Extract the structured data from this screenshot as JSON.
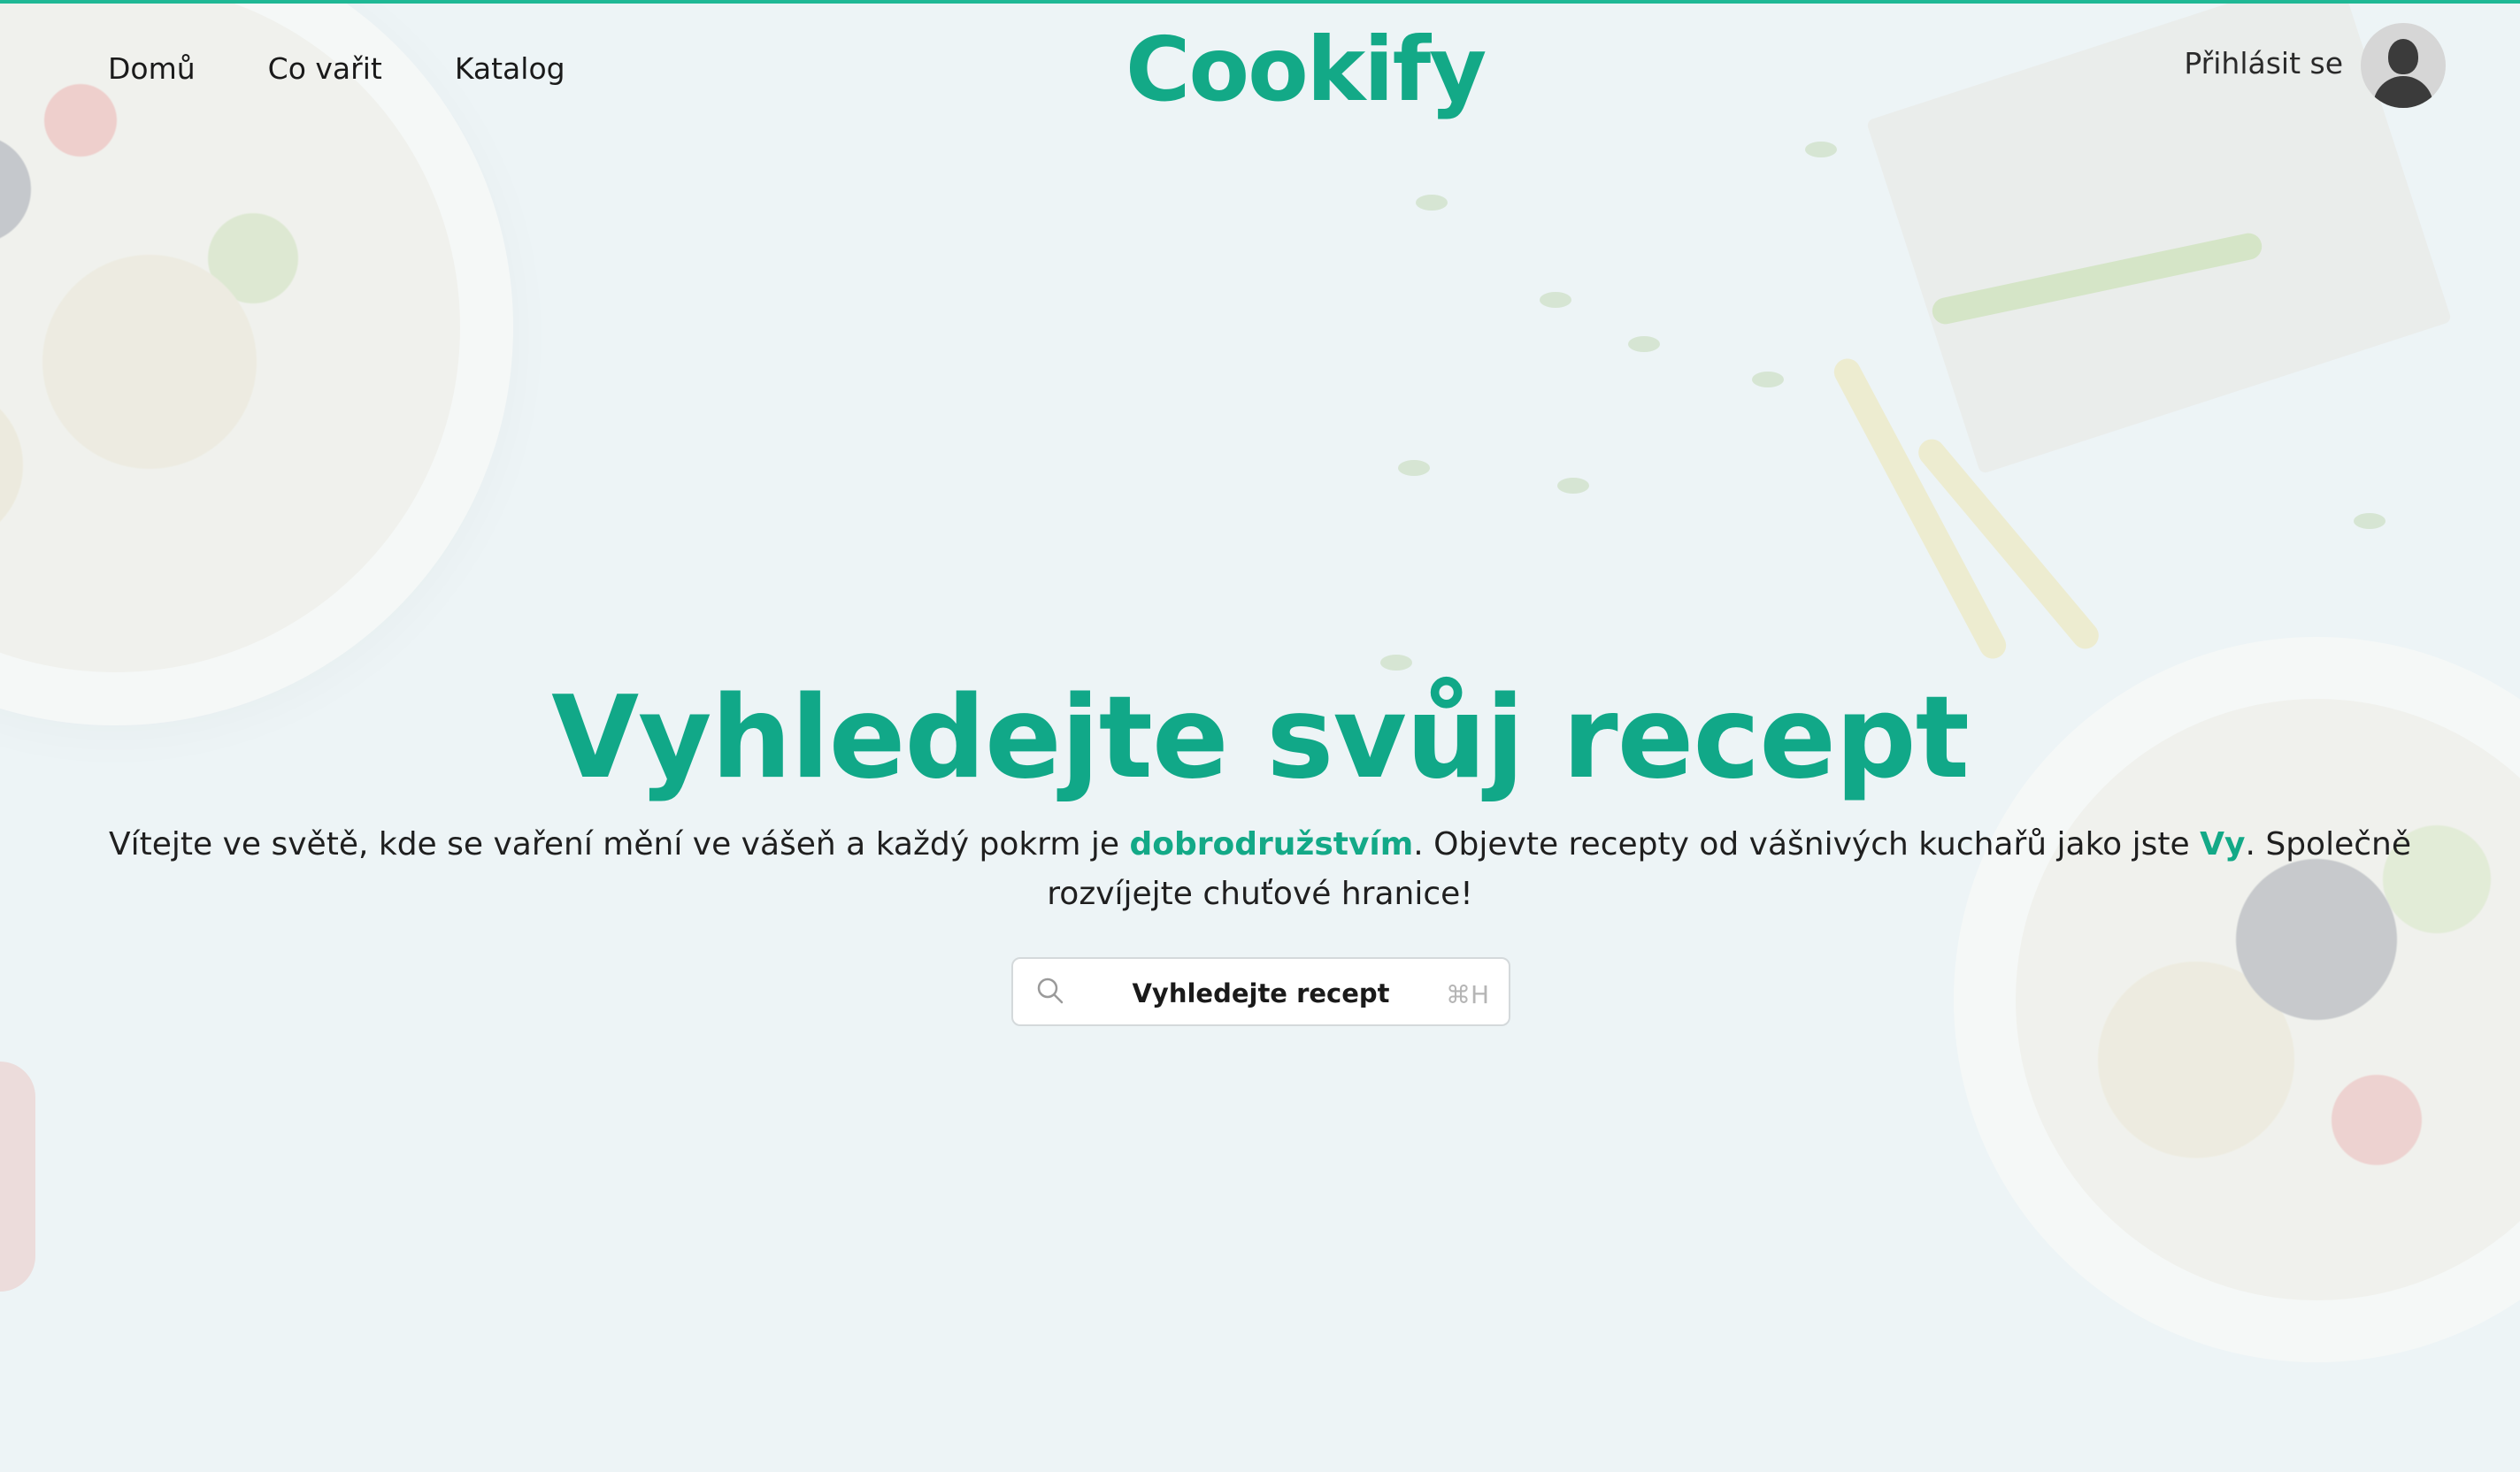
{
  "brand": {
    "logo": "Cookify",
    "accent": "#13a987"
  },
  "nav": {
    "items": [
      {
        "label": "Domů"
      },
      {
        "label": "Co vařit"
      },
      {
        "label": "Katalog"
      }
    ]
  },
  "account": {
    "login_label": "Přihlásit se",
    "avatar_icon": "user-silhouette-icon"
  },
  "hero": {
    "title": "Vyhledejte svůj recept",
    "intro_part1": "Vítejte ve světě, kde se vaření mění ve vášeň a každý pokrm je ",
    "intro_highlight1": "dobrodružstvím",
    "intro_part2": ". Objevte recepty od vášnivých kuchařů jako jste ",
    "intro_highlight2": "Vy",
    "intro_part3": ". Společně rozvíjejte chuťové hranice!"
  },
  "search": {
    "icon": "search-icon",
    "placeholder": "Vyhledejte recept",
    "shortcut": "⌘H"
  }
}
